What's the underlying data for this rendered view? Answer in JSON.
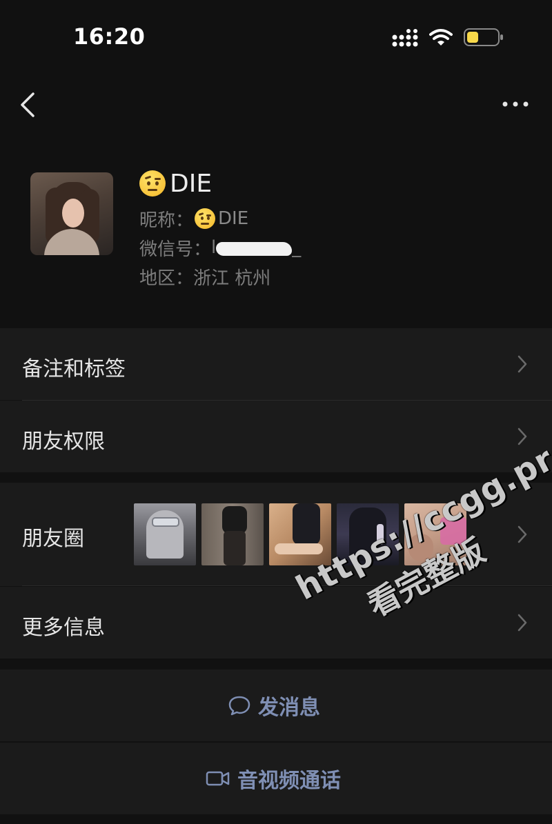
{
  "status_bar": {
    "time": "16:20",
    "signal_icon": "cellular-signal-icon",
    "wifi_icon": "wifi-icon",
    "battery_icon": "battery-icon",
    "battery_color": "#f7d84a"
  },
  "nav": {
    "back_icon": "chevron-left-icon",
    "more_icon": "more-horizontal-icon"
  },
  "profile": {
    "display_name": "DIE",
    "nickname_label": "昵称：",
    "nickname_value": "DIE",
    "wechat_id_label": "微信号：",
    "wechat_id_prefix": "l",
    "wechat_id_suffix": "_",
    "region_label": "地区：",
    "region_value": "浙江 杭州",
    "emoji": "raised-eyebrow-face-emoji"
  },
  "rows": {
    "notes_tags": "备注和标签",
    "friend_permissions": "朋友权限",
    "moments": "朋友圈",
    "more_info": "更多信息"
  },
  "actions": {
    "send_message": "发消息",
    "video_call": "音视频通话",
    "accent_color": "#7f8fb4"
  },
  "watermark": {
    "url": "https://ccgg.pro",
    "text": "看完整版"
  },
  "theme": {
    "background": "#111111",
    "row_background": "#1b1b1b",
    "text_primary": "#e6e6e6",
    "text_secondary": "#7d7d7d"
  }
}
